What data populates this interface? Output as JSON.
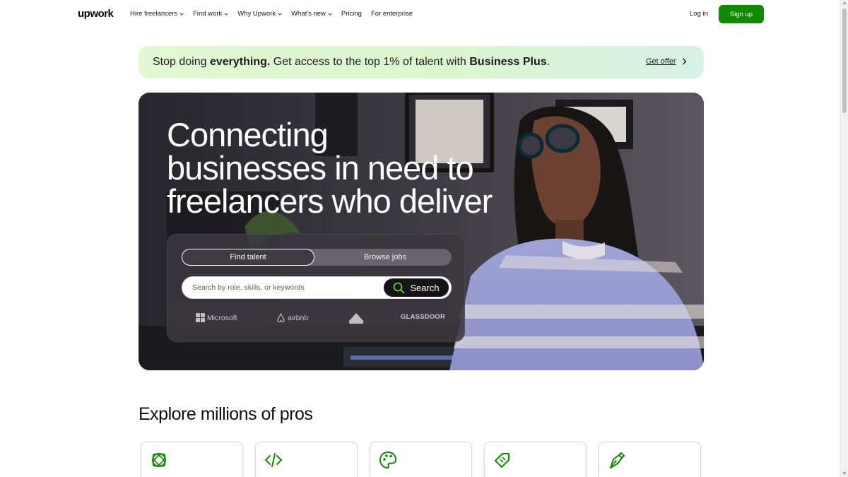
{
  "header": {
    "logo": "upwork",
    "nav": [
      {
        "label": "Hire freelancers",
        "dropdown": true
      },
      {
        "label": "Find work",
        "dropdown": true
      },
      {
        "label": "Why Upwork",
        "dropdown": true
      },
      {
        "label": "What's new",
        "dropdown": true
      },
      {
        "label": "Pricing",
        "dropdown": false
      },
      {
        "label": "For enterprise",
        "dropdown": false
      }
    ],
    "login": "Log in",
    "signup": "Sign up"
  },
  "promo": {
    "text_pre": "Stop doing ",
    "text_bold1": "everything.",
    "text_mid": " Get access to the top 1% of talent with ",
    "text_bold2": "Business Plus",
    "text_post": ".",
    "link": "Get offer"
  },
  "hero": {
    "title_lines": [
      "Connecting",
      "businesses in need to",
      "freelancers who deliver"
    ],
    "tabs": {
      "talent": "Find talent",
      "jobs": "Browse jobs"
    },
    "search": {
      "placeholder": "Search by role, skills, or keywords",
      "button": "Search"
    },
    "brands": [
      "Microsoft",
      "airbnb",
      "",
      "GLASSDOOR"
    ]
  },
  "explore": {
    "title": "Explore millions of pros",
    "categories": [
      {
        "icon": "ai-icon"
      },
      {
        "icon": "code-icon"
      },
      {
        "icon": "palette-icon"
      },
      {
        "icon": "tag-icon"
      },
      {
        "icon": "pen-nib-icon"
      }
    ]
  },
  "colors": {
    "brand_green": "#108a00",
    "promo_bg": "#e3f7d4",
    "text_dark": "#001e00"
  }
}
